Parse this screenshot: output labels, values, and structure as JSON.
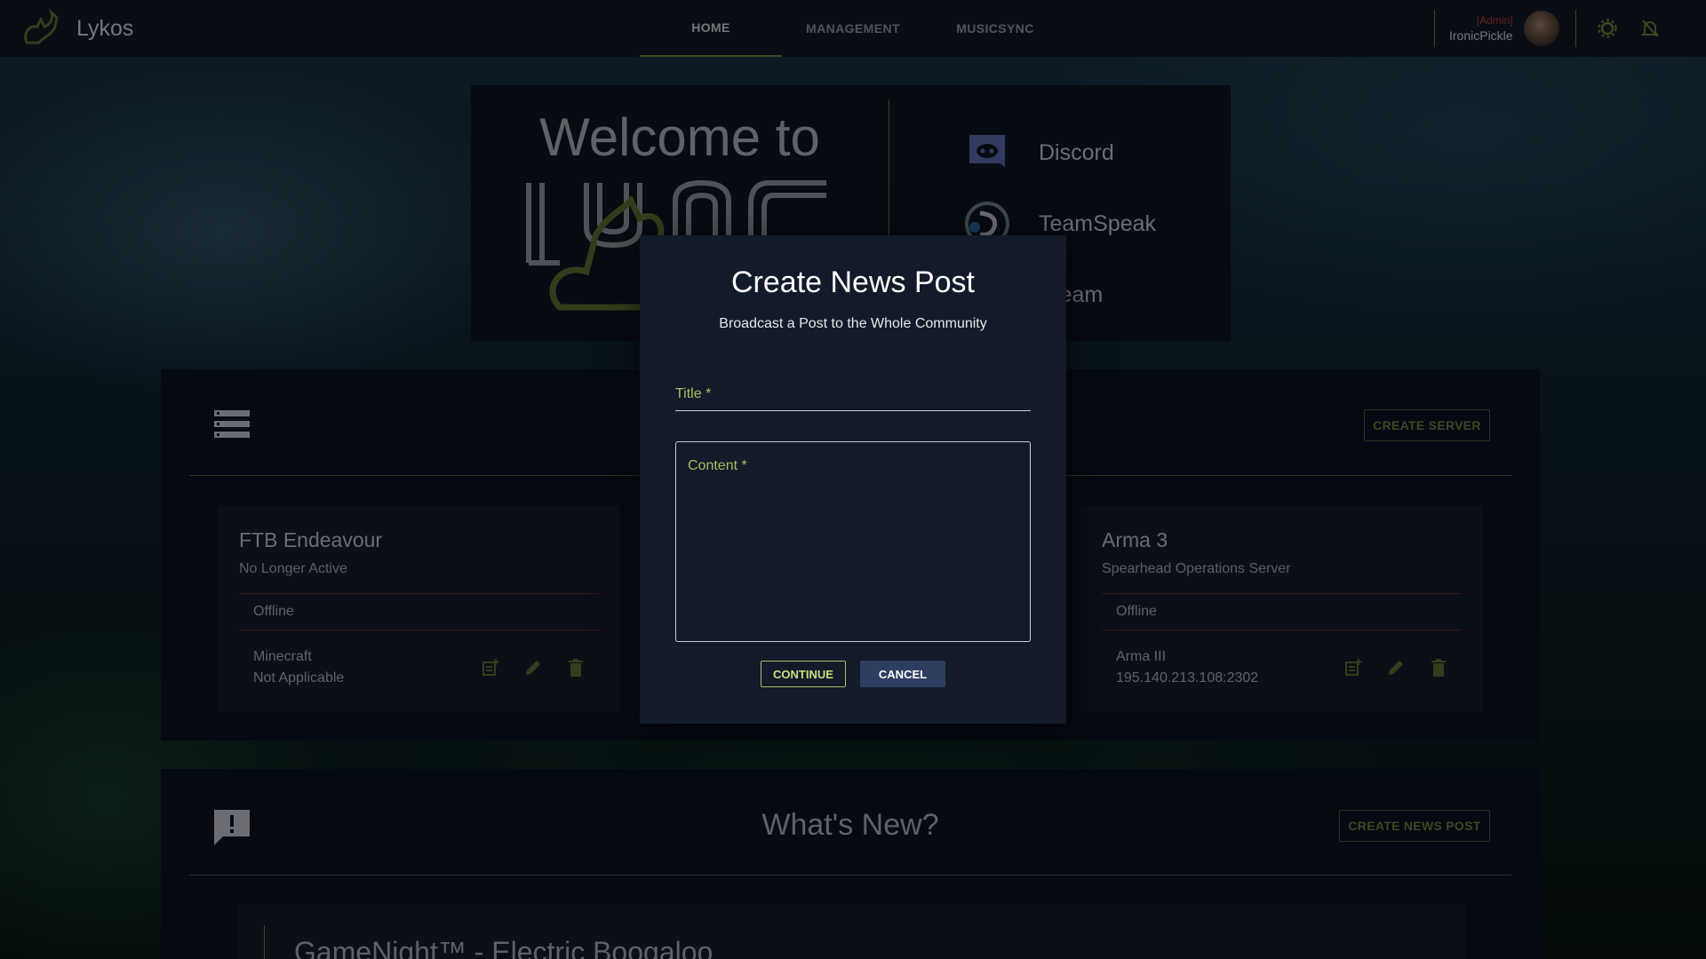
{
  "app": {
    "name": "Lykos"
  },
  "nav": {
    "tabs": [
      {
        "label": "HOME"
      },
      {
        "label": "MANAGEMENT"
      },
      {
        "label": "MUSICSYNC"
      }
    ]
  },
  "user": {
    "role": "[Admin]",
    "name": "IronicPickle"
  },
  "welcome": {
    "title": "Welcome to",
    "links": [
      {
        "label": "Discord"
      },
      {
        "label": "TeamSpeak"
      },
      {
        "label": "Steam"
      }
    ]
  },
  "servers": {
    "create_label": "CREATE SERVER",
    "cards": [
      {
        "title": "FTB Endeavour",
        "subtitle": "No Longer Active",
        "status": "Offline",
        "game": "Minecraft",
        "address": "Not Applicable"
      },
      {
        "title": "Arma 3",
        "subtitle": "Spearhead Operations Server",
        "status": "Offline",
        "game": "Arma III",
        "address": "195.140.213.108:2302"
      }
    ]
  },
  "news": {
    "title": "What's New?",
    "create_label": "CREATE NEWS POST",
    "post_title": "GameNight™ - Electric Boogaloo"
  },
  "dialog": {
    "title": "Create News Post",
    "subtitle": "Broadcast a Post to the Whole Community",
    "title_label": "Title *",
    "content_label": "Content *",
    "continue_label": "CONTINUE",
    "cancel_label": "CANCEL"
  },
  "colors": {
    "accent": "#6a7a3a",
    "field_accent": "#a8c060",
    "danger": "#b03a3a",
    "primary": "#2e3e60"
  }
}
